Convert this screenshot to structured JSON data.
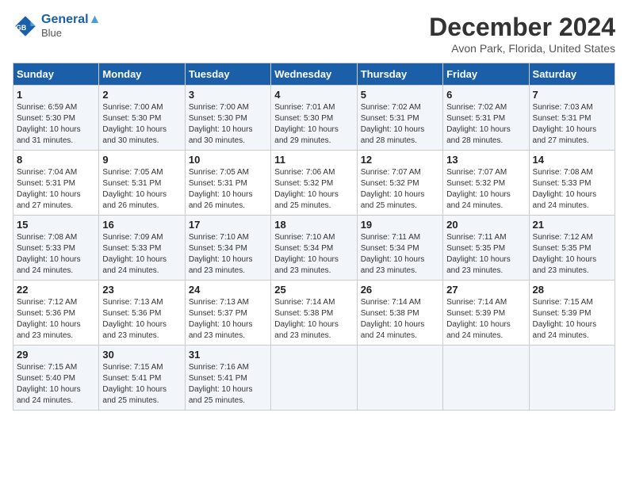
{
  "logo": {
    "line1": "General",
    "line2": "Blue"
  },
  "title": "December 2024",
  "location": "Avon Park, Florida, United States",
  "days_of_week": [
    "Sunday",
    "Monday",
    "Tuesday",
    "Wednesday",
    "Thursday",
    "Friday",
    "Saturday"
  ],
  "weeks": [
    [
      {
        "day": "1",
        "info": "Sunrise: 6:59 AM\nSunset: 5:30 PM\nDaylight: 10 hours\nand 31 minutes."
      },
      {
        "day": "2",
        "info": "Sunrise: 7:00 AM\nSunset: 5:30 PM\nDaylight: 10 hours\nand 30 minutes."
      },
      {
        "day": "3",
        "info": "Sunrise: 7:00 AM\nSunset: 5:30 PM\nDaylight: 10 hours\nand 30 minutes."
      },
      {
        "day": "4",
        "info": "Sunrise: 7:01 AM\nSunset: 5:30 PM\nDaylight: 10 hours\nand 29 minutes."
      },
      {
        "day": "5",
        "info": "Sunrise: 7:02 AM\nSunset: 5:31 PM\nDaylight: 10 hours\nand 28 minutes."
      },
      {
        "day": "6",
        "info": "Sunrise: 7:02 AM\nSunset: 5:31 PM\nDaylight: 10 hours\nand 28 minutes."
      },
      {
        "day": "7",
        "info": "Sunrise: 7:03 AM\nSunset: 5:31 PM\nDaylight: 10 hours\nand 27 minutes."
      }
    ],
    [
      {
        "day": "8",
        "info": "Sunrise: 7:04 AM\nSunset: 5:31 PM\nDaylight: 10 hours\nand 27 minutes."
      },
      {
        "day": "9",
        "info": "Sunrise: 7:05 AM\nSunset: 5:31 PM\nDaylight: 10 hours\nand 26 minutes."
      },
      {
        "day": "10",
        "info": "Sunrise: 7:05 AM\nSunset: 5:31 PM\nDaylight: 10 hours\nand 26 minutes."
      },
      {
        "day": "11",
        "info": "Sunrise: 7:06 AM\nSunset: 5:32 PM\nDaylight: 10 hours\nand 25 minutes."
      },
      {
        "day": "12",
        "info": "Sunrise: 7:07 AM\nSunset: 5:32 PM\nDaylight: 10 hours\nand 25 minutes."
      },
      {
        "day": "13",
        "info": "Sunrise: 7:07 AM\nSunset: 5:32 PM\nDaylight: 10 hours\nand 24 minutes."
      },
      {
        "day": "14",
        "info": "Sunrise: 7:08 AM\nSunset: 5:33 PM\nDaylight: 10 hours\nand 24 minutes."
      }
    ],
    [
      {
        "day": "15",
        "info": "Sunrise: 7:08 AM\nSunset: 5:33 PM\nDaylight: 10 hours\nand 24 minutes."
      },
      {
        "day": "16",
        "info": "Sunrise: 7:09 AM\nSunset: 5:33 PM\nDaylight: 10 hours\nand 24 minutes."
      },
      {
        "day": "17",
        "info": "Sunrise: 7:10 AM\nSunset: 5:34 PM\nDaylight: 10 hours\nand 23 minutes."
      },
      {
        "day": "18",
        "info": "Sunrise: 7:10 AM\nSunset: 5:34 PM\nDaylight: 10 hours\nand 23 minutes."
      },
      {
        "day": "19",
        "info": "Sunrise: 7:11 AM\nSunset: 5:34 PM\nDaylight: 10 hours\nand 23 minutes."
      },
      {
        "day": "20",
        "info": "Sunrise: 7:11 AM\nSunset: 5:35 PM\nDaylight: 10 hours\nand 23 minutes."
      },
      {
        "day": "21",
        "info": "Sunrise: 7:12 AM\nSunset: 5:35 PM\nDaylight: 10 hours\nand 23 minutes."
      }
    ],
    [
      {
        "day": "22",
        "info": "Sunrise: 7:12 AM\nSunset: 5:36 PM\nDaylight: 10 hours\nand 23 minutes."
      },
      {
        "day": "23",
        "info": "Sunrise: 7:13 AM\nSunset: 5:36 PM\nDaylight: 10 hours\nand 23 minutes."
      },
      {
        "day": "24",
        "info": "Sunrise: 7:13 AM\nSunset: 5:37 PM\nDaylight: 10 hours\nand 23 minutes."
      },
      {
        "day": "25",
        "info": "Sunrise: 7:14 AM\nSunset: 5:38 PM\nDaylight: 10 hours\nand 23 minutes."
      },
      {
        "day": "26",
        "info": "Sunrise: 7:14 AM\nSunset: 5:38 PM\nDaylight: 10 hours\nand 24 minutes."
      },
      {
        "day": "27",
        "info": "Sunrise: 7:14 AM\nSunset: 5:39 PM\nDaylight: 10 hours\nand 24 minutes."
      },
      {
        "day": "28",
        "info": "Sunrise: 7:15 AM\nSunset: 5:39 PM\nDaylight: 10 hours\nand 24 minutes."
      }
    ],
    [
      {
        "day": "29",
        "info": "Sunrise: 7:15 AM\nSunset: 5:40 PM\nDaylight: 10 hours\nand 24 minutes."
      },
      {
        "day": "30",
        "info": "Sunrise: 7:15 AM\nSunset: 5:41 PM\nDaylight: 10 hours\nand 25 minutes."
      },
      {
        "day": "31",
        "info": "Sunrise: 7:16 AM\nSunset: 5:41 PM\nDaylight: 10 hours\nand 25 minutes."
      },
      null,
      null,
      null,
      null
    ]
  ]
}
